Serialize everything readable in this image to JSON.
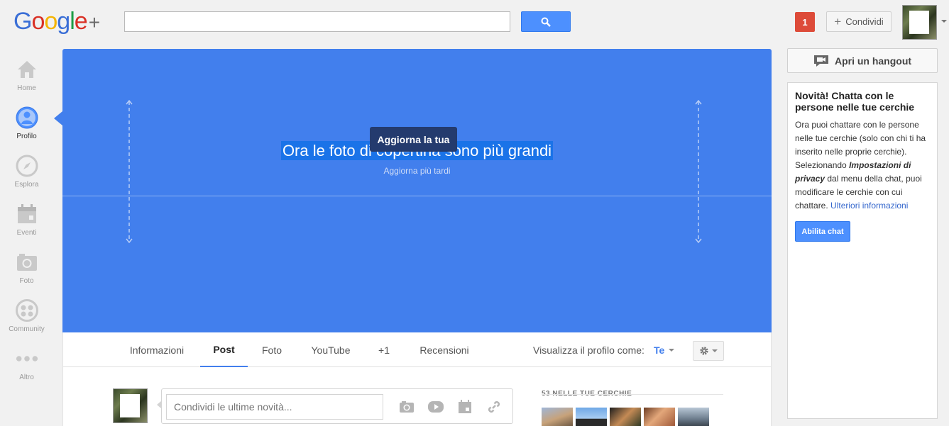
{
  "header": {
    "logo_text": "Google",
    "logo_plus": "+",
    "search": {
      "value": "",
      "placeholder": ""
    },
    "search_icon": "search-icon",
    "notification_count": "1",
    "share_label": "Condividi",
    "share_icon": "plus-icon"
  },
  "sidebar": {
    "items": [
      {
        "label": "Home",
        "icon": "home-icon",
        "active": false
      },
      {
        "label": "Profilo",
        "icon": "profile-icon",
        "active": true
      },
      {
        "label": "Esplora",
        "icon": "compass-icon",
        "active": false
      },
      {
        "label": "Eventi",
        "icon": "calendar-icon",
        "active": false
      },
      {
        "label": "Foto",
        "icon": "camera-icon",
        "active": false
      },
      {
        "label": "Community",
        "icon": "community-icon",
        "active": false
      },
      {
        "label": "Altro",
        "icon": "more-dots-icon",
        "active": false
      }
    ]
  },
  "cover": {
    "title": "Ora le foto di copertina sono più grandi",
    "update_button": "Aggiorna la tua",
    "later_link": "Aggiorna più tardi",
    "color": "#427fed"
  },
  "profile_tabs": {
    "tabs": [
      {
        "label": "Informazioni",
        "active": false
      },
      {
        "label": "Post",
        "active": true
      },
      {
        "label": "Foto",
        "active": false
      },
      {
        "label": "YouTube",
        "active": false
      },
      {
        "label": "+1",
        "active": false
      },
      {
        "label": "Recensioni",
        "active": false
      }
    ],
    "view_as_label": "Visualizza il profilo come:",
    "view_as_value": "Te",
    "settings_icon": "gear-icon"
  },
  "composer": {
    "placeholder": "Condividi le ultime novità...",
    "icons": [
      "camera-icon",
      "video-icon",
      "calendar-icon",
      "link-icon"
    ]
  },
  "circles": {
    "title": "53 NELLE TUE CERCHIE"
  },
  "right": {
    "hangout_label": "Apri un hangout",
    "hangout_icon": "video-chat-icon",
    "chat_card": {
      "title": "Novità! Chatta con le persone nelle tue cerchie",
      "body_1": "Ora puoi chattare con le persone nelle tue cerchie (solo con chi ti ha inserito nelle proprie cerchie). Selezionando ",
      "body_em": "Impostazioni di privacy",
      "body_2": " dal menu della chat, puoi modificare le cerchie con cui chattare. ",
      "link": "Ulteriori informazioni",
      "button": "Abilita chat"
    }
  },
  "colors": {
    "accent": "#427fed",
    "button_blue": "#4d90fe",
    "notification_red": "#dd4b39",
    "background": "#f1f1f1"
  }
}
